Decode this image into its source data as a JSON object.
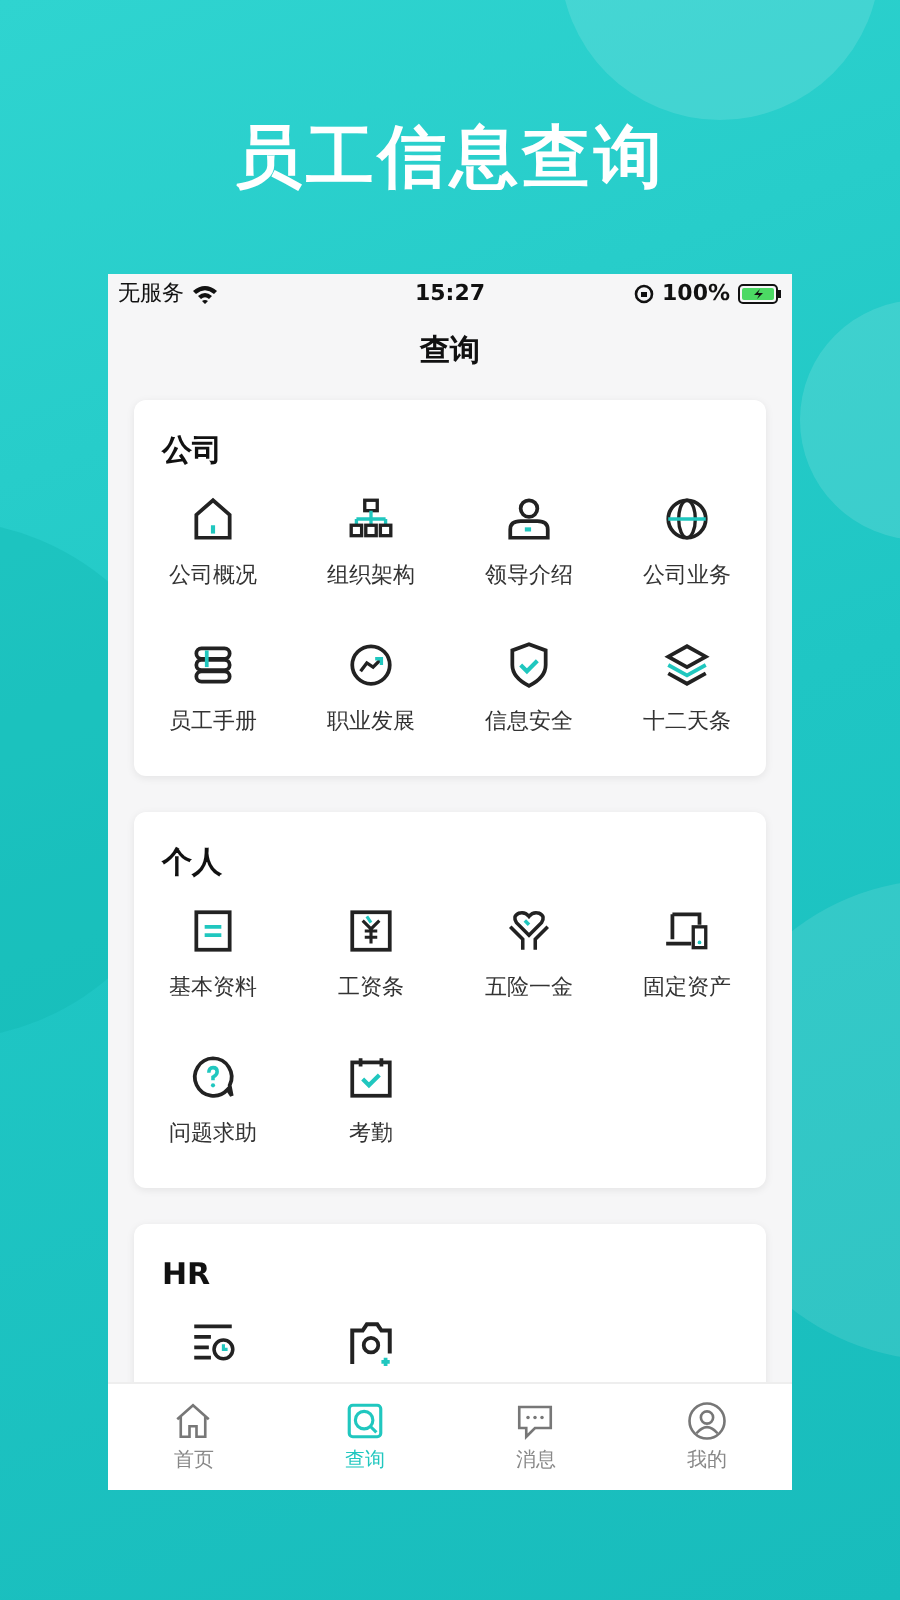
{
  "headline": "员工信息查询",
  "status_bar": {
    "carrier": "无服务",
    "time": "15:27",
    "battery": "100%"
  },
  "nav": {
    "title": "查询"
  },
  "sections": [
    {
      "title": "公司",
      "items": [
        {
          "kind": "tile",
          "label": "公司概况"
        },
        {
          "kind": "tile",
          "label": "组织架构"
        },
        {
          "kind": "tile",
          "label": "领导介绍"
        },
        {
          "kind": "tile",
          "label": "公司业务"
        },
        {
          "kind": "tile",
          "label": "员工手册"
        },
        {
          "kind": "tile",
          "label": "职业发展"
        },
        {
          "kind": "tile",
          "label": "信息安全"
        },
        {
          "kind": "tile",
          "label": "十二天条"
        }
      ]
    },
    {
      "title": "个人",
      "items": [
        {
          "kind": "tile",
          "label": "基本资料"
        },
        {
          "kind": "tile",
          "label": "工资条"
        },
        {
          "kind": "tile",
          "label": "五险一金"
        },
        {
          "kind": "tile",
          "label": "固定资产"
        },
        {
          "kind": "tile",
          "label": "问题求助"
        },
        {
          "kind": "tile",
          "label": "考勤"
        }
      ]
    },
    {
      "title": "HR",
      "items": [
        {
          "kind": "icon-only"
        },
        {
          "kind": "icon-only"
        }
      ]
    }
  ],
  "tabs": [
    {
      "label": "首页",
      "selected": false
    },
    {
      "label": "查询",
      "selected": true
    },
    {
      "label": "消息",
      "selected": false
    },
    {
      "label": "我的",
      "selected": false
    }
  ]
}
